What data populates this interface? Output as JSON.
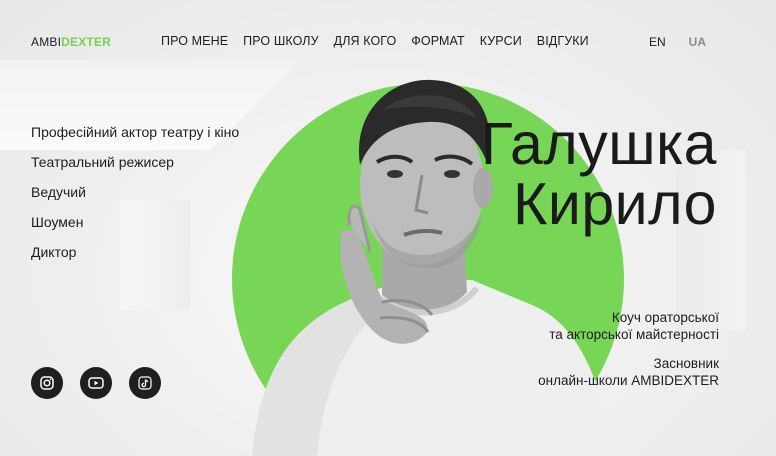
{
  "header": {
    "logo_part1": "AMBI",
    "logo_part2": "DEXTER",
    "nav": [
      "ПРО МЕНЕ",
      "ПРО ШКОЛУ",
      "ДЛЯ КОГО",
      "ФОРМАТ",
      "КУРСИ",
      "ВІДГУКИ"
    ],
    "lang_en": "EN",
    "lang_ua": "UA"
  },
  "roles": [
    "Професійний актор театру і кіно",
    "Театральний режисер",
    "Ведучий",
    "Шоумен",
    "Диктор"
  ],
  "hero": {
    "name_line1": "Галушка",
    "name_line2": "Кирило",
    "desc1_line1": "Коуч ораторської",
    "desc1_line2": "та акторської майстерності",
    "desc2_line1": "Засновник",
    "desc2_line2": "онлайн-школи AMBIDEXTER"
  },
  "socials": [
    "instagram-icon",
    "youtube-icon",
    "tiktok-icon"
  ],
  "colors": {
    "accent": "#77d656",
    "text": "#1d1d1d",
    "background": "#f3f3f3"
  }
}
